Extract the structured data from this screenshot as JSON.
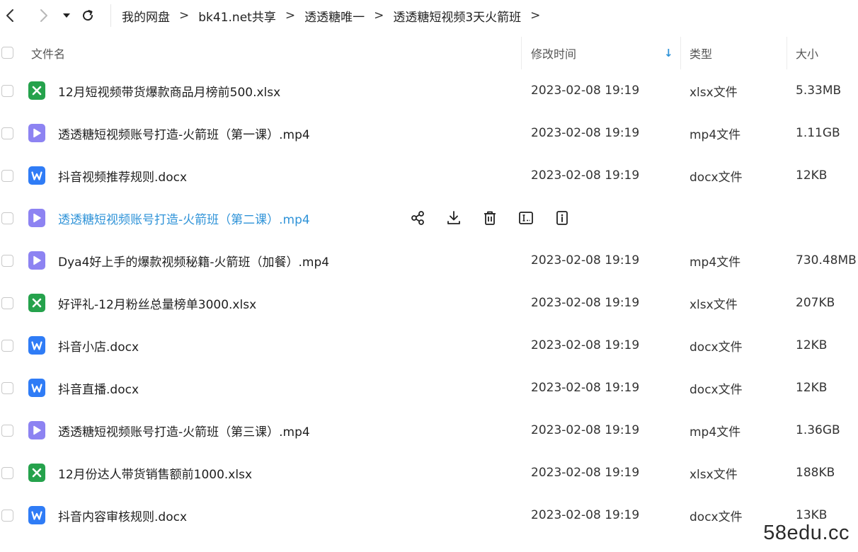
{
  "breadcrumb": {
    "items": [
      "我的网盘",
      "bk41.net共享",
      "透透糖唯一",
      "透透糖短视频3天火箭班"
    ],
    "separator": ">"
  },
  "columns": {
    "name": "文件名",
    "modified": "修改时间",
    "sort_arrow": "↓",
    "type": "类型",
    "size": "大小"
  },
  "colors": {
    "xlsx_icon": "#25a24c",
    "mp4_icon": "#8d83f2",
    "docx_icon": "#2f7cf6",
    "hover_text": "#2f93d8"
  },
  "files": [
    {
      "name": "12月短视频带货爆款商品月榜前500.xlsx",
      "modified": "2023-02-08 19:19",
      "type": "xlsx文件",
      "size": "5.33MB",
      "icon": "excel-file-icon"
    },
    {
      "name": "透透糖短视频账号打造-火箭班（第一课）.mp4",
      "modified": "2023-02-08 19:19",
      "type": "mp4文件",
      "size": "1.11GB",
      "icon": "video-file-icon"
    },
    {
      "name": "抖音视频推荐规则.docx",
      "modified": "2023-02-08 19:19",
      "type": "docx文件",
      "size": "12KB",
      "icon": "word-file-icon"
    },
    {
      "name": "透透糖短视频账号打造-火箭班（第二课）.mp4",
      "modified": "",
      "type": "",
      "size": "",
      "icon": "video-file-icon",
      "hovered": true
    },
    {
      "name": "Dya4好上手的爆款视频秘籍-火箭班（加餐）.mp4",
      "modified": "2023-02-08 19:19",
      "type": "mp4文件",
      "size": "730.48MB",
      "icon": "video-file-icon"
    },
    {
      "name": "好评礼-12月粉丝总量榜单3000.xlsx",
      "modified": "2023-02-08 19:19",
      "type": "xlsx文件",
      "size": "207KB",
      "icon": "excel-file-icon"
    },
    {
      "name": "抖音小店.docx",
      "modified": "2023-02-08 19:19",
      "type": "docx文件",
      "size": "12KB",
      "icon": "word-file-icon"
    },
    {
      "name": "抖音直播.docx",
      "modified": "2023-02-08 19:19",
      "type": "docx文件",
      "size": "12KB",
      "icon": "word-file-icon"
    },
    {
      "name": "透透糖短视频账号打造-火箭班（第三课）.mp4",
      "modified": "2023-02-08 19:19",
      "type": "mp4文件",
      "size": "1.36GB",
      "icon": "video-file-icon"
    },
    {
      "name": "12月份达人带货销售额前1000.xlsx",
      "modified": "2023-02-08 19:19",
      "type": "xlsx文件",
      "size": "188KB",
      "icon": "excel-file-icon"
    },
    {
      "name": "抖音内容审核规则.docx",
      "modified": "2023-02-08 19:19",
      "type": "docx文件",
      "size": "13KB",
      "icon": "word-file-icon"
    }
  ],
  "row_actions": [
    "share-icon",
    "download-icon",
    "delete-icon",
    "rename-icon",
    "details-icon"
  ],
  "watermark": "58edu.cc"
}
